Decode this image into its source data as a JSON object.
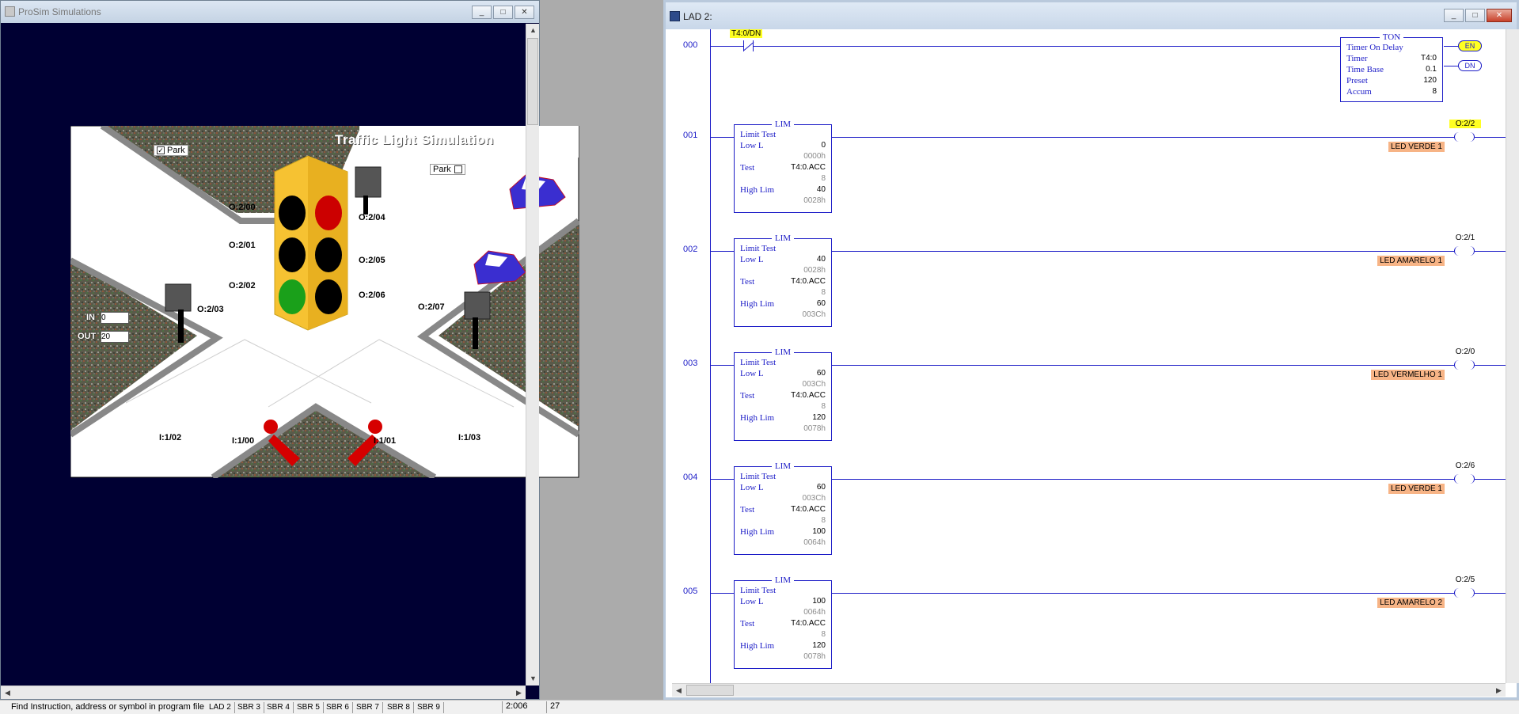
{
  "prosim": {
    "title": "ProSim Simulations",
    "scene_title": "Traffic Light Simulation",
    "park_left": "Park",
    "park_right": "Park",
    "in_label": "IN",
    "in_value": "0",
    "out_label": "OUT",
    "out_value": "20",
    "outputs": [
      "O:2/00",
      "O:2/01",
      "O:2/02",
      "O:2/03",
      "O:2/04",
      "O:2/05",
      "O:2/06",
      "O:2/07"
    ],
    "inputs": [
      "I:1/02",
      "I:1/00",
      "I:1/01",
      "I:1/03"
    ],
    "lights": {
      "top": "#cc0000",
      "middle": "#000000",
      "bottom": "#1aa01a",
      "housing": "#f6c232"
    },
    "background": "#000033"
  },
  "lad": {
    "title": "LAD 2:",
    "rungs": [
      {
        "num": "000"
      },
      {
        "num": "001"
      },
      {
        "num": "002"
      },
      {
        "num": "003"
      },
      {
        "num": "004"
      },
      {
        "num": "005"
      }
    ],
    "contact": {
      "address": "T4:0/DN"
    },
    "ton": {
      "name": "TON",
      "desc": "Timer On Delay",
      "timer_label": "Timer",
      "timer": "T4:0",
      "base_label": "Time Base",
      "base": "0.1",
      "preset_label": "Preset",
      "preset": "120",
      "accum_label": "Accum",
      "accum": "8",
      "en": "EN",
      "dn": "DN"
    },
    "lims": [
      {
        "name": "LIM",
        "desc": "Limit Test",
        "low_label": "Low L",
        "low": "0",
        "low_hex": "0000h",
        "test_label": "Test",
        "test": "T4:0.ACC",
        "test_val": "8",
        "high_label": "High Lim",
        "high": "40",
        "high_hex": "0028h",
        "out": "O:2/2",
        "tag": "LED VERDE 1"
      },
      {
        "name": "LIM",
        "desc": "Limit Test",
        "low_label": "Low L",
        "low": "40",
        "low_hex": "0028h",
        "test_label": "Test",
        "test": "T4:0.ACC",
        "test_val": "8",
        "high_label": "High Lim",
        "high": "60",
        "high_hex": "003Ch",
        "out": "O:2/1",
        "tag": "LED AMARELO 1"
      },
      {
        "name": "LIM",
        "desc": "Limit Test",
        "low_label": "Low L",
        "low": "60",
        "low_hex": "003Ch",
        "test_label": "Test",
        "test": "T4:0.ACC",
        "test_val": "8",
        "high_label": "High Lim",
        "high": "120",
        "high_hex": "0078h",
        "out": "O:2/0",
        "tag": "LED VERMELHO 1"
      },
      {
        "name": "LIM",
        "desc": "Limit Test",
        "low_label": "Low L",
        "low": "60",
        "low_hex": "003Ch",
        "test_label": "Test",
        "test": "T4:0.ACC",
        "test_val": "8",
        "high_label": "High Lim",
        "high": "100",
        "high_hex": "0064h",
        "out": "O:2/6",
        "tag": "LED VERDE 1"
      },
      {
        "name": "LIM",
        "desc": "Limit Test",
        "low_label": "Low L",
        "low": "100",
        "low_hex": "0064h",
        "test_label": "Test",
        "test": "T4:0.ACC",
        "test_val": "8",
        "high_label": "High Lim",
        "high": "120",
        "high_hex": "0078h",
        "out": "O:2/5",
        "tag": "LED AMARELO  2"
      }
    ]
  },
  "status": {
    "find": "Find Instruction, address or symbol in program file",
    "tabs": [
      "LAD 2",
      "SBR 3",
      "SBR 4",
      "SBR 5",
      "SBR 6",
      "SBR 7",
      "SBR 8",
      "SBR 9"
    ],
    "pos": "2:006",
    "num": "27"
  }
}
